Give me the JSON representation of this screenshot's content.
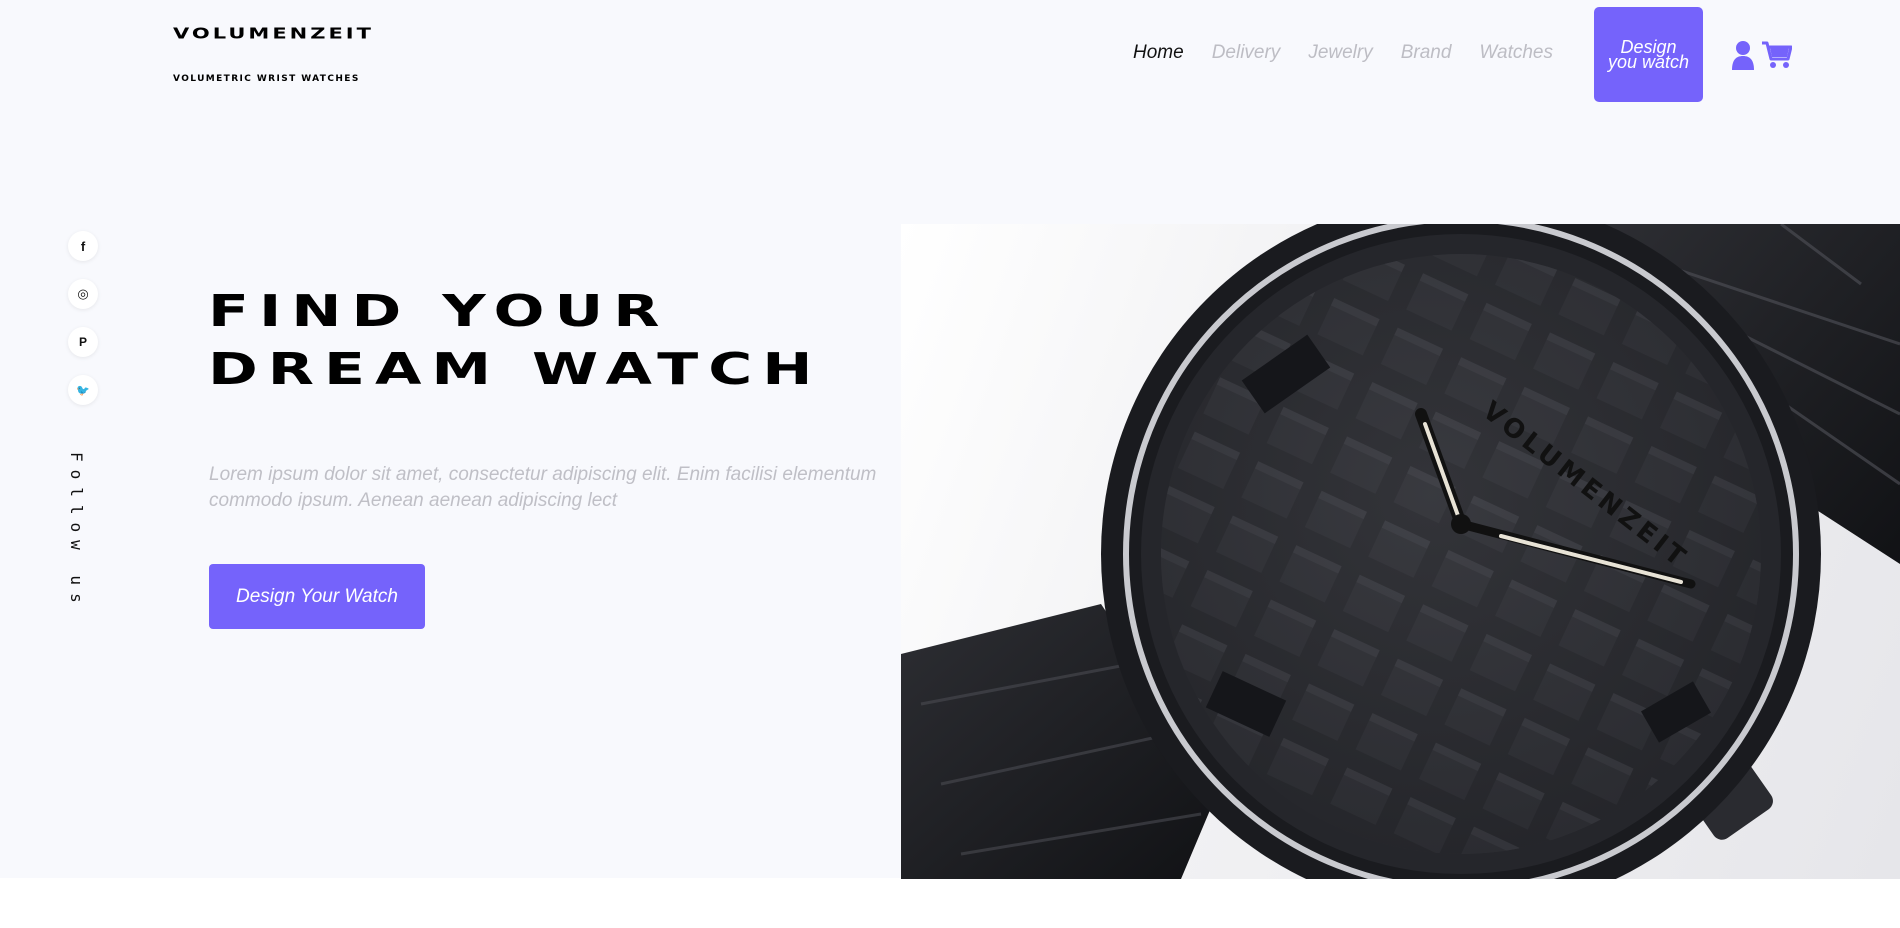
{
  "brand": {
    "name": "VOLUMENZEIT",
    "tagline": "VOLUMETRIC WRIST WATCHES",
    "accent": "#7563fb"
  },
  "nav": {
    "items": [
      {
        "label": "Home",
        "active": true
      },
      {
        "label": "Delivery",
        "active": false
      },
      {
        "label": "Jewelry",
        "active": false
      },
      {
        "label": "Brand",
        "active": false
      },
      {
        "label": "Watches",
        "active": false
      }
    ],
    "cta_label": "Design you watch",
    "icons": [
      "user-icon",
      "cart-icon"
    ]
  },
  "social": {
    "icons": [
      "facebook-icon",
      "instagram-icon",
      "pinterest-icon",
      "twitter-icon"
    ],
    "glyphs": [
      "f",
      "◎",
      "P",
      "🐦"
    ],
    "follow_label": "Follow us"
  },
  "hero": {
    "headline_line1": "FIND YOUR",
    "headline_line2": "DREAM WATCH",
    "body": "Lorem ipsum dolor sit amet, consectetur adipiscing elit. Enim facilisi elementum commodo ipsum. Aenean aenean adipiscing lect",
    "button_label": "Design Your Watch",
    "image_alt": "Black VOLUMENZEIT wrist watch with 3D textured dial",
    "dial_text": "VOLUMENZEIT"
  }
}
